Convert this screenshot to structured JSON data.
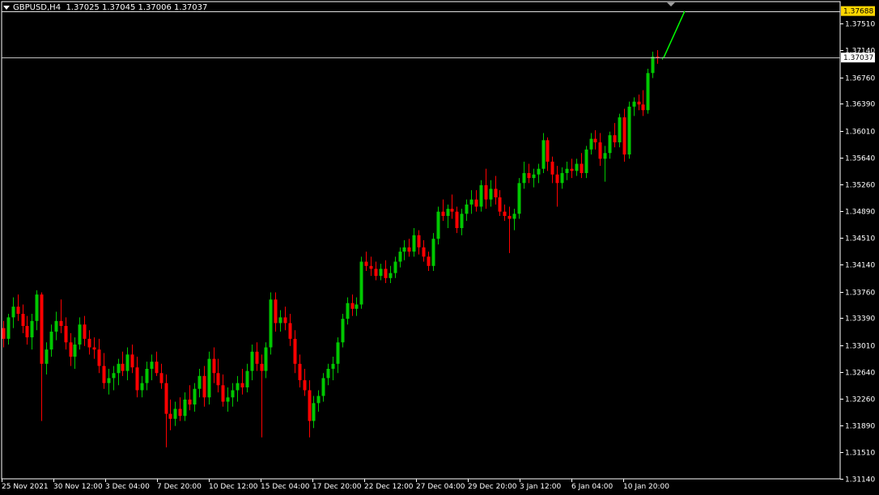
{
  "window": {
    "symbol_timeframe": "GBPUSD,H4",
    "ohlc_readout": "1.37025 1.37045 1.37006 1.37037"
  },
  "colors": {
    "background": "#000000",
    "frame": "#ffffff",
    "bull": "#00c800",
    "bear": "#ff0000",
    "bid_line": "#c0c0c0",
    "level_label_bg": "#ffd700",
    "bid_label_bg": "#ffffff",
    "trend_line": "#00ff00"
  },
  "chart_data": {
    "type": "candlestick",
    "symbol": "GBPUSD",
    "timeframe": "H4",
    "ylim": [
      1.3114,
      1.3782
    ],
    "y_ticks": [
      "1.37510",
      "1.37140",
      "1.36760",
      "1.36390",
      "1.36010",
      "1.35640",
      "1.35260",
      "1.34890",
      "1.34510",
      "1.34140",
      "1.33760",
      "1.33390",
      "1.33010",
      "1.32640",
      "1.32260",
      "1.31890",
      "1.31510",
      "1.31140"
    ],
    "x_labels": [
      "25 Nov 2021",
      "30 Nov 12:00",
      "3 Dec 04:00",
      "7 Dec 20:00",
      "10 Dec 12:00",
      "15 Dec 04:00",
      "17 Dec 20:00",
      "22 Dec 12:00",
      "27 Dec 04:00",
      "29 Dec 20:00",
      "3 Jan 12:00",
      "6 Jan 04:00",
      "10 Jan 20:00"
    ],
    "current_bid": 1.37037,
    "current_bid_label": "1.37037",
    "level_line": 1.37688,
    "level_label": "1.37688",
    "trendline": [
      1.37037,
      1.37688
    ],
    "candles": [
      [
        1.3325,
        1.3335,
        1.3298,
        1.331
      ],
      [
        1.331,
        1.3345,
        1.3302,
        1.334
      ],
      [
        1.334,
        1.3368,
        1.3325,
        1.3355
      ],
      [
        1.3355,
        1.3372,
        1.3335,
        1.3345
      ],
      [
        1.3345,
        1.3358,
        1.3318,
        1.3328
      ],
      [
        1.3328,
        1.3342,
        1.3302,
        1.3312
      ],
      [
        1.3312,
        1.3345,
        1.3295,
        1.3335
      ],
      [
        1.3335,
        1.3378,
        1.3322,
        1.3372
      ],
      [
        1.3372,
        1.3375,
        1.3195,
        1.3275
      ],
      [
        1.3275,
        1.3305,
        1.326,
        1.3295
      ],
      [
        1.3295,
        1.333,
        1.3285,
        1.332
      ],
      [
        1.332,
        1.3348,
        1.3308,
        1.3335
      ],
      [
        1.3335,
        1.3365,
        1.3318,
        1.3328
      ],
      [
        1.3328,
        1.334,
        1.3295,
        1.3305
      ],
      [
        1.3305,
        1.3318,
        1.3272,
        1.3285
      ],
      [
        1.3285,
        1.3312,
        1.3268,
        1.3302
      ],
      [
        1.3302,
        1.334,
        1.3295,
        1.333
      ],
      [
        1.333,
        1.3342,
        1.33,
        1.331
      ],
      [
        1.331,
        1.3322,
        1.3288,
        1.3298
      ],
      [
        1.3298,
        1.3312,
        1.3282,
        1.3295
      ],
      [
        1.3295,
        1.331,
        1.3262,
        1.3272
      ],
      [
        1.3272,
        1.329,
        1.324,
        1.3248
      ],
      [
        1.3248,
        1.3268,
        1.3232,
        1.3255
      ],
      [
        1.3255,
        1.3272,
        1.3238,
        1.3262
      ],
      [
        1.3262,
        1.3282,
        1.3245,
        1.3275
      ],
      [
        1.3275,
        1.3292,
        1.3258,
        1.3265
      ],
      [
        1.3265,
        1.3298,
        1.3252,
        1.3288
      ],
      [
        1.3288,
        1.3302,
        1.3262,
        1.327
      ],
      [
        1.327,
        1.3285,
        1.3228,
        1.3238
      ],
      [
        1.3238,
        1.3258,
        1.3228,
        1.3248
      ],
      [
        1.3248,
        1.3278,
        1.3238,
        1.3268
      ],
      [
        1.3268,
        1.3288,
        1.3252,
        1.3278
      ],
      [
        1.3278,
        1.3292,
        1.3258,
        1.3262
      ],
      [
        1.3262,
        1.3275,
        1.324,
        1.3248
      ],
      [
        1.3248,
        1.326,
        1.3158,
        1.3205
      ],
      [
        1.3205,
        1.3225,
        1.3182,
        1.3198
      ],
      [
        1.3198,
        1.3222,
        1.3188,
        1.3212
      ],
      [
        1.3212,
        1.3228,
        1.3195,
        1.3202
      ],
      [
        1.3202,
        1.3235,
        1.3195,
        1.3225
      ],
      [
        1.3225,
        1.3245,
        1.321,
        1.3218
      ],
      [
        1.3218,
        1.3248,
        1.3208,
        1.324
      ],
      [
        1.324,
        1.3268,
        1.3228,
        1.3258
      ],
      [
        1.3258,
        1.3272,
        1.3215,
        1.3228
      ],
      [
        1.3228,
        1.3292,
        1.3218,
        1.3282
      ],
      [
        1.3282,
        1.3298,
        1.3248,
        1.3262
      ],
      [
        1.3262,
        1.3282,
        1.3235,
        1.3245
      ],
      [
        1.3245,
        1.326,
        1.3215,
        1.3222
      ],
      [
        1.3222,
        1.3242,
        1.3208,
        1.3228
      ],
      [
        1.3228,
        1.3248,
        1.3215,
        1.3238
      ],
      [
        1.3238,
        1.3258,
        1.3222,
        1.3248
      ],
      [
        1.3248,
        1.3268,
        1.3232,
        1.3242
      ],
      [
        1.3242,
        1.3275,
        1.3235,
        1.3265
      ],
      [
        1.3265,
        1.3302,
        1.3252,
        1.3292
      ],
      [
        1.3292,
        1.3305,
        1.3265,
        1.3275
      ],
      [
        1.3275,
        1.3288,
        1.3172,
        1.3265
      ],
      [
        1.3265,
        1.3305,
        1.3255,
        1.3298
      ],
      [
        1.3298,
        1.3375,
        1.3288,
        1.3365
      ],
      [
        1.3365,
        1.3375,
        1.332,
        1.3332
      ],
      [
        1.3332,
        1.335,
        1.332,
        1.334
      ],
      [
        1.334,
        1.3355,
        1.3322,
        1.3332
      ],
      [
        1.3332,
        1.3345,
        1.33,
        1.331
      ],
      [
        1.331,
        1.3322,
        1.3262,
        1.3275
      ],
      [
        1.3275,
        1.3288,
        1.3242,
        1.3252
      ],
      [
        1.3252,
        1.3268,
        1.323,
        1.3238
      ],
      [
        1.3238,
        1.3252,
        1.3172,
        1.3195
      ],
      [
        1.3195,
        1.323,
        1.3185,
        1.322
      ],
      [
        1.322,
        1.3238,
        1.3208,
        1.323
      ],
      [
        1.323,
        1.3262,
        1.3222,
        1.3255
      ],
      [
        1.3255,
        1.3275,
        1.3245,
        1.3268
      ],
      [
        1.3268,
        1.3285,
        1.3252,
        1.3275
      ],
      [
        1.3275,
        1.3312,
        1.3262,
        1.3305
      ],
      [
        1.3305,
        1.3345,
        1.3298,
        1.3338
      ],
      [
        1.3338,
        1.3368,
        1.333,
        1.336
      ],
      [
        1.336,
        1.3372,
        1.3342,
        1.3352
      ],
      [
        1.3352,
        1.3368,
        1.3342,
        1.3358
      ],
      [
        1.3358,
        1.3425,
        1.3352,
        1.3418
      ],
      [
        1.3418,
        1.3432,
        1.3405,
        1.3412
      ],
      [
        1.3412,
        1.3425,
        1.3398,
        1.3408
      ],
      [
        1.3408,
        1.3418,
        1.3392,
        1.3398
      ],
      [
        1.3398,
        1.3415,
        1.3392,
        1.3408
      ],
      [
        1.3408,
        1.342,
        1.3388,
        1.3395
      ],
      [
        1.3395,
        1.3412,
        1.3388,
        1.3402
      ],
      [
        1.3402,
        1.3425,
        1.3395,
        1.3418
      ],
      [
        1.3418,
        1.3438,
        1.341,
        1.3432
      ],
      [
        1.3432,
        1.3448,
        1.342,
        1.3438
      ],
      [
        1.3438,
        1.345,
        1.3425,
        1.3432
      ],
      [
        1.3432,
        1.3465,
        1.3425,
        1.3455
      ],
      [
        1.3455,
        1.3462,
        1.3428,
        1.3438
      ],
      [
        1.3438,
        1.3448,
        1.3418,
        1.3425
      ],
      [
        1.3425,
        1.3432,
        1.3405,
        1.3412
      ],
      [
        1.3412,
        1.3458,
        1.3405,
        1.345
      ],
      [
        1.345,
        1.3495,
        1.3442,
        1.3488
      ],
      [
        1.3488,
        1.3505,
        1.3475,
        1.3482
      ],
      [
        1.3482,
        1.3498,
        1.3465,
        1.3492
      ],
      [
        1.3492,
        1.3512,
        1.3478,
        1.3488
      ],
      [
        1.3488,
        1.3495,
        1.3458,
        1.3465
      ],
      [
        1.3465,
        1.3492,
        1.3455,
        1.3485
      ],
      [
        1.3485,
        1.3505,
        1.3475,
        1.3498
      ],
      [
        1.3498,
        1.3518,
        1.3485,
        1.3505
      ],
      [
        1.3505,
        1.3518,
        1.3488,
        1.3495
      ],
      [
        1.3495,
        1.3532,
        1.3488,
        1.3525
      ],
      [
        1.3525,
        1.3548,
        1.3492,
        1.3505
      ],
      [
        1.3505,
        1.3532,
        1.3495,
        1.352
      ],
      [
        1.352,
        1.3538,
        1.3498,
        1.3508
      ],
      [
        1.3508,
        1.3518,
        1.3482,
        1.3488
      ],
      [
        1.3488,
        1.3498,
        1.3475,
        1.3482
      ],
      [
        1.3482,
        1.3495,
        1.343,
        1.3478
      ],
      [
        1.3478,
        1.3492,
        1.3462,
        1.3485
      ],
      [
        1.3485,
        1.3535,
        1.3478,
        1.3528
      ],
      [
        1.3528,
        1.3558,
        1.352,
        1.3542
      ],
      [
        1.3542,
        1.3555,
        1.3528,
        1.3535
      ],
      [
        1.3535,
        1.3548,
        1.3522,
        1.354
      ],
      [
        1.354,
        1.3555,
        1.3528,
        1.3548
      ],
      [
        1.3548,
        1.3598,
        1.3542,
        1.3588
      ],
      [
        1.3588,
        1.3592,
        1.3545,
        1.3558
      ],
      [
        1.3558,
        1.3565,
        1.3528,
        1.354
      ],
      [
        1.354,
        1.3552,
        1.3495,
        1.3528
      ],
      [
        1.3528,
        1.355,
        1.352,
        1.3542
      ],
      [
        1.3542,
        1.3558,
        1.3532,
        1.3548
      ],
      [
        1.3548,
        1.3562,
        1.3535,
        1.3545
      ],
      [
        1.3545,
        1.3562,
        1.3538,
        1.3555
      ],
      [
        1.3555,
        1.357,
        1.3535,
        1.3542
      ],
      [
        1.3542,
        1.358,
        1.3535,
        1.3575
      ],
      [
        1.3575,
        1.3598,
        1.3568,
        1.359
      ],
      [
        1.359,
        1.3602,
        1.3575,
        1.3585
      ],
      [
        1.3585,
        1.3598,
        1.3552,
        1.3562
      ],
      [
        1.3562,
        1.358,
        1.353,
        1.357
      ],
      [
        1.357,
        1.36,
        1.3562,
        1.3595
      ],
      [
        1.3595,
        1.3612,
        1.3578,
        1.3585
      ],
      [
        1.3585,
        1.3625,
        1.3578,
        1.362
      ],
      [
        1.362,
        1.3632,
        1.3558,
        1.3568
      ],
      [
        1.3568,
        1.3642,
        1.3562,
        1.3635
      ],
      [
        1.3635,
        1.3648,
        1.3622,
        1.3642
      ],
      [
        1.3642,
        1.3652,
        1.363,
        1.3638
      ],
      [
        1.3638,
        1.3658,
        1.3622,
        1.363
      ],
      [
        1.363,
        1.3688,
        1.3625,
        1.3682
      ],
      [
        1.3682,
        1.3712,
        1.3675,
        1.3705
      ],
      [
        1.3705,
        1.3714,
        1.3695,
        1.3703
      ],
      [
        1.3703,
        1.37045,
        1.37006,
        1.37037
      ]
    ]
  }
}
